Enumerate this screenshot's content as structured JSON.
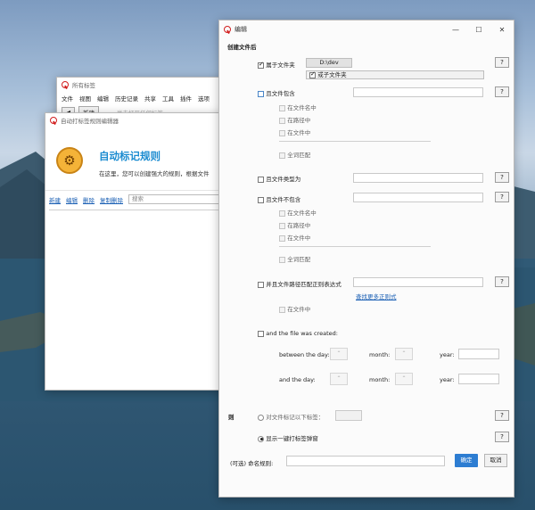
{
  "desktop": {},
  "back_window_1": {
    "title": "所有标签",
    "menu": [
      "文件",
      "视图",
      "编辑",
      "历史记录",
      "共享",
      "工具",
      "插件",
      "选项"
    ],
    "new_button": "新建",
    "hint": "尚未打开任何标签。"
  },
  "back_window_2": {
    "title": "自动打标签规则编辑器",
    "heading": "自动标记规则",
    "description": "在这里，您可以创建强大的规则，根据文件",
    "actions": [
      "新建",
      "编辑",
      "删除",
      "复制删除"
    ],
    "search_placeholder": "搜索"
  },
  "dialog": {
    "title": "编辑",
    "controls": {
      "minimize": "—",
      "maximize": "☐",
      "close": "✕"
    },
    "section_title": "创建文件后",
    "belongs_folder": {
      "label": "属于文件夹",
      "path": "D:\\dev",
      "subfolder_label": "或子文件夹",
      "help": "?"
    },
    "name_contains": {
      "label": "且文件包含",
      "opt1": "在文件名中",
      "opt2": "在路径中",
      "opt3": "在文件中",
      "whole": "全词匹配",
      "help": "?"
    },
    "file_type": {
      "label": "且文件类型为",
      "help": "?"
    },
    "not_contains": {
      "label": "且文件不包含",
      "opt1": "在文件名中",
      "opt2": "在路径中",
      "opt3": "在文件中",
      "whole": "全词匹配",
      "help": "?"
    },
    "regex": {
      "label": "并且文件路径匹配正则表达式",
      "link": "查找更多正则式",
      "opt": "在文件中",
      "help": "?"
    },
    "created": {
      "label": "and the file was created:",
      "between": "between the day:",
      "and_day": "and the day:",
      "month": "month:",
      "year": "year:",
      "spinner": "⌃"
    },
    "then": {
      "label": "则",
      "radio1": "对文件标记以下标签：",
      "radio2": "显示一键打标签弹窗",
      "help": "?"
    },
    "rule_name_label": "(可选) 命名规则:",
    "ok": "确定",
    "cancel": "取消"
  }
}
